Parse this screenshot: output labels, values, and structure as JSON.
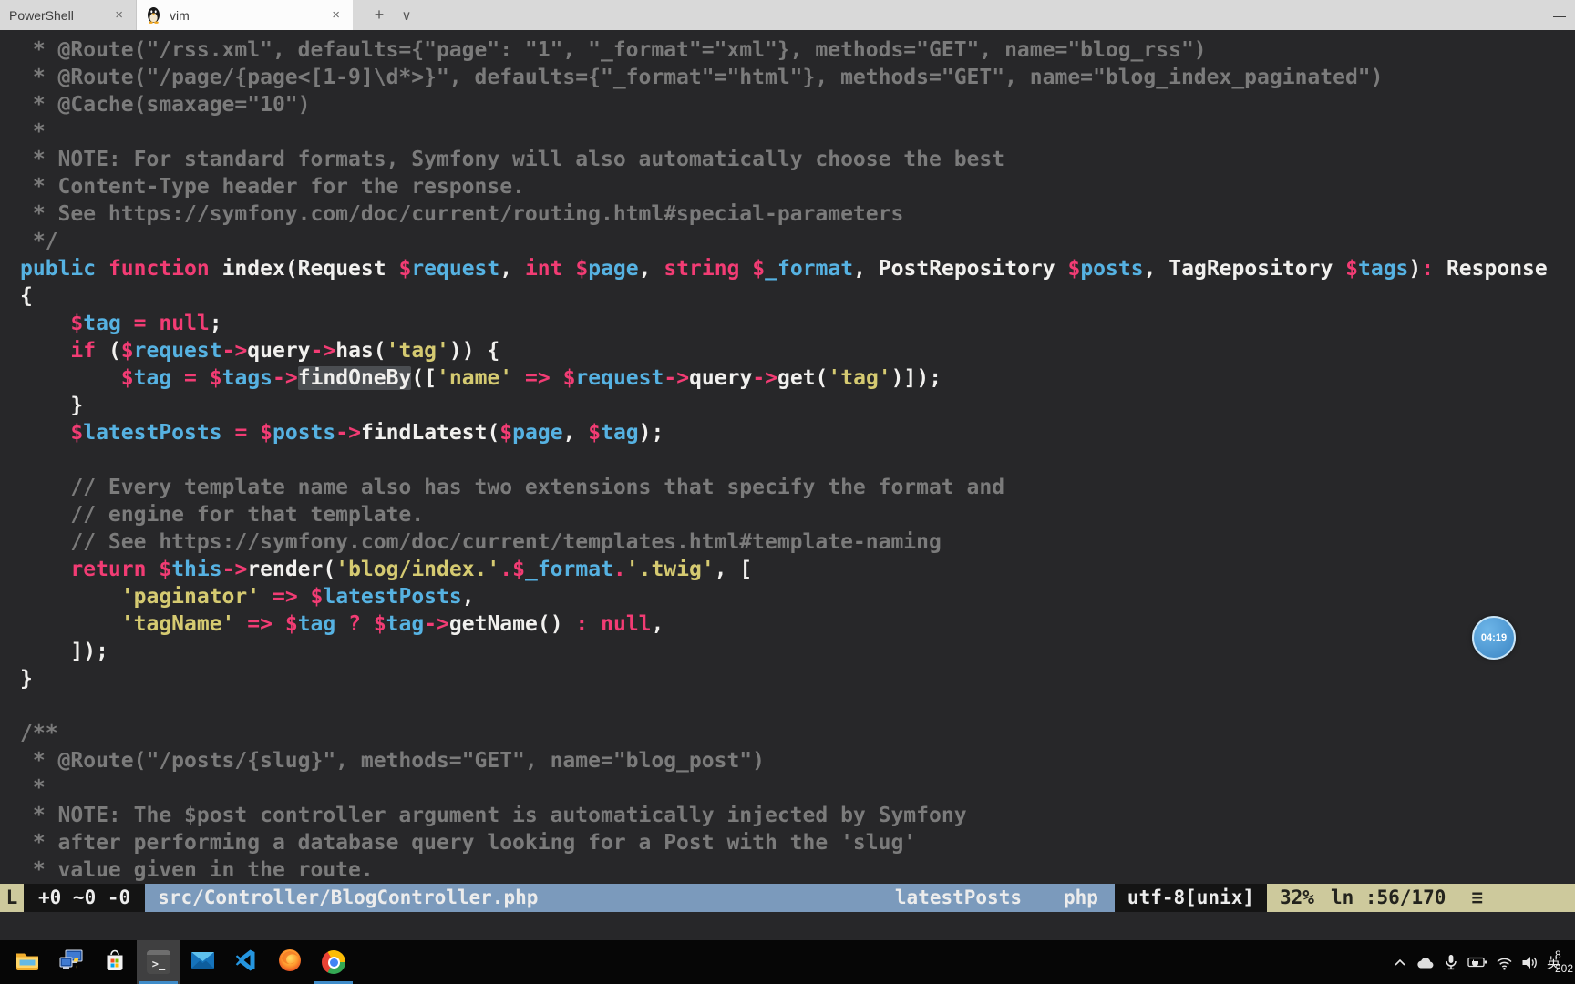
{
  "window": {
    "tabs": [
      {
        "label": "PowerShell"
      },
      {
        "label": "vim",
        "icon": "tux-linux"
      }
    ],
    "close_glyph": "×",
    "new_tab_glyph": "+",
    "dropdown_glyph": "∨",
    "minimize_glyph": "—"
  },
  "editor": {
    "lines": [
      {
        "segs": [
          [
            "g",
            " * @Route(\"/rss.xml\", defaults={\"page\": \"1\", \"_format\"=\"xml\"}, methods=\"GET\", name=\"blog_rss\")"
          ]
        ]
      },
      {
        "segs": [
          [
            "g",
            " * @Route(\"/page/{page<[1-9]\\d*>}\", defaults={\"_format\"=\"html\"}, methods=\"GET\", name=\"blog_index_paginated\")"
          ]
        ]
      },
      {
        "segs": [
          [
            "g",
            " * @Cache(smaxage=\"10\")"
          ]
        ]
      },
      {
        "segs": [
          [
            "g",
            " *"
          ]
        ]
      },
      {
        "segs": [
          [
            "g",
            " * NOTE: For standard formats, Symfony will also automatically choose the best"
          ]
        ]
      },
      {
        "segs": [
          [
            "g",
            " * Content-Type header for the response."
          ]
        ]
      },
      {
        "segs": [
          [
            "g",
            " * See https://symfony.com/doc/current/routing.html#special-parameters"
          ]
        ]
      },
      {
        "segs": [
          [
            "g",
            " */"
          ]
        ]
      },
      {
        "segs": [
          [
            "b",
            "public"
          ],
          [
            "w",
            " "
          ],
          [
            "p",
            "function"
          ],
          [
            "w",
            " index(Request "
          ],
          [
            "p",
            "$"
          ],
          [
            "b",
            "request"
          ],
          [
            "w",
            ", "
          ],
          [
            "p",
            "int"
          ],
          [
            "w",
            " "
          ],
          [
            "p",
            "$"
          ],
          [
            "b",
            "page"
          ],
          [
            "w",
            ", "
          ],
          [
            "p",
            "string"
          ],
          [
            "w",
            " "
          ],
          [
            "p",
            "$"
          ],
          [
            "b",
            "_format"
          ],
          [
            "w",
            ", PostRepository "
          ],
          [
            "p",
            "$"
          ],
          [
            "b",
            "posts"
          ],
          [
            "w",
            ", TagRepository "
          ],
          [
            "p",
            "$"
          ],
          [
            "b",
            "tags"
          ],
          [
            "w",
            ")"
          ],
          [
            "p",
            ":"
          ],
          [
            "w",
            " Response"
          ]
        ]
      },
      {
        "segs": [
          [
            "w",
            "{"
          ]
        ]
      },
      {
        "segs": [
          [
            "w",
            "    "
          ],
          [
            "p",
            "$"
          ],
          [
            "b",
            "tag"
          ],
          [
            "w",
            " "
          ],
          [
            "p",
            "="
          ],
          [
            "w",
            " "
          ],
          [
            "p",
            "null"
          ],
          [
            "w",
            ";"
          ]
        ]
      },
      {
        "segs": [
          [
            "w",
            "    "
          ],
          [
            "p",
            "if"
          ],
          [
            "w",
            " ("
          ],
          [
            "p",
            "$"
          ],
          [
            "b",
            "request"
          ],
          [
            "p",
            "->"
          ],
          [
            "w",
            "query"
          ],
          [
            "p",
            "->"
          ],
          [
            "w",
            "has("
          ],
          [
            "y",
            "'tag'"
          ],
          [
            "w",
            ")) {"
          ]
        ]
      },
      {
        "segs": [
          [
            "w",
            "        "
          ],
          [
            "p",
            "$"
          ],
          [
            "b",
            "tag"
          ],
          [
            "w",
            " "
          ],
          [
            "p",
            "="
          ],
          [
            "w",
            " "
          ],
          [
            "p",
            "$"
          ],
          [
            "b",
            "tags"
          ],
          [
            "p",
            "->"
          ],
          [
            "w",
            "findOneBy",
            "hl"
          ],
          [
            "w",
            "(["
          ],
          [
            "y",
            "'name'"
          ],
          [
            "w",
            " "
          ],
          [
            "p",
            "=>"
          ],
          [
            "w",
            " "
          ],
          [
            "p",
            "$"
          ],
          [
            "b",
            "request"
          ],
          [
            "p",
            "->"
          ],
          [
            "w",
            "query"
          ],
          [
            "p",
            "->"
          ],
          [
            "w",
            "get("
          ],
          [
            "y",
            "'tag'"
          ],
          [
            "w",
            ")]);"
          ]
        ]
      },
      {
        "segs": [
          [
            "w",
            "    }"
          ]
        ]
      },
      {
        "segs": [
          [
            "w",
            "    "
          ],
          [
            "p",
            "$"
          ],
          [
            "b",
            "latestPosts"
          ],
          [
            "w",
            " "
          ],
          [
            "p",
            "="
          ],
          [
            "w",
            " "
          ],
          [
            "p",
            "$"
          ],
          [
            "b",
            "posts"
          ],
          [
            "p",
            "->"
          ],
          [
            "w",
            "findLatest("
          ],
          [
            "p",
            "$"
          ],
          [
            "b",
            "page"
          ],
          [
            "w",
            ", "
          ],
          [
            "p",
            "$"
          ],
          [
            "b",
            "tag"
          ],
          [
            "w",
            ");"
          ]
        ]
      },
      {
        "segs": []
      },
      {
        "segs": [
          [
            "g",
            "    // Every template name also has two extensions that specify the format and"
          ]
        ]
      },
      {
        "segs": [
          [
            "g",
            "    // engine for that template."
          ]
        ]
      },
      {
        "segs": [
          [
            "g",
            "    // See https://symfony.com/doc/current/templates.html#template-naming"
          ]
        ]
      },
      {
        "segs": [
          [
            "w",
            "    "
          ],
          [
            "p",
            "return"
          ],
          [
            "w",
            " "
          ],
          [
            "p",
            "$"
          ],
          [
            "b",
            "this"
          ],
          [
            "p",
            "->"
          ],
          [
            "w",
            "render("
          ],
          [
            "y",
            "'blog/index.'"
          ],
          [
            "p",
            "."
          ],
          [
            "p",
            "$"
          ],
          [
            "b",
            "_format"
          ],
          [
            "p",
            "."
          ],
          [
            "y",
            "'.twig'"
          ],
          [
            "w",
            ", ["
          ]
        ]
      },
      {
        "segs": [
          [
            "w",
            "        "
          ],
          [
            "y",
            "'paginator'"
          ],
          [
            "w",
            " "
          ],
          [
            "p",
            "=>"
          ],
          [
            "w",
            " "
          ],
          [
            "p",
            "$"
          ],
          [
            "b",
            "latestPosts"
          ],
          [
            "w",
            ","
          ]
        ]
      },
      {
        "segs": [
          [
            "w",
            "        "
          ],
          [
            "y",
            "'tagName'"
          ],
          [
            "w",
            " "
          ],
          [
            "p",
            "=>"
          ],
          [
            "w",
            " "
          ],
          [
            "p",
            "$"
          ],
          [
            "b",
            "tag"
          ],
          [
            "w",
            " "
          ],
          [
            "p",
            "?"
          ],
          [
            "w",
            " "
          ],
          [
            "p",
            "$"
          ],
          [
            "b",
            "tag"
          ],
          [
            "p",
            "->"
          ],
          [
            "w",
            "getName() "
          ],
          [
            "p",
            ":"
          ],
          [
            "w",
            " "
          ],
          [
            "p",
            "null"
          ],
          [
            "w",
            ","
          ]
        ]
      },
      {
        "segs": [
          [
            "w",
            "    ]);"
          ]
        ]
      },
      {
        "segs": [
          [
            "w",
            "}"
          ]
        ]
      },
      {
        "segs": []
      },
      {
        "segs": [
          [
            "g",
            "/**"
          ]
        ]
      },
      {
        "segs": [
          [
            "g",
            " * @Route(\"/posts/{slug}\", methods=\"GET\", name=\"blog_post\")"
          ]
        ]
      },
      {
        "segs": [
          [
            "g",
            " *"
          ]
        ]
      },
      {
        "segs": [
          [
            "g",
            " * NOTE: The $post controller argument is automatically injected by Symfony"
          ]
        ]
      },
      {
        "segs": [
          [
            "g",
            " * after performing a database query looking for a Post with the 'slug'"
          ]
        ]
      },
      {
        "segs": [
          [
            "g",
            " * value given in the route."
          ]
        ]
      }
    ]
  },
  "statusline": {
    "mode_truncated": "L",
    "git_hunks": "+0 ~0 -0",
    "file_path": "src/Controller/BlogController.php",
    "current_word": "latestPosts",
    "filetype": "php",
    "encoding": "utf-8[unix]",
    "scroll_percent": "32%",
    "line_info": "ln :56/170",
    "menu_glyph": "≡"
  },
  "badge": {
    "timer": "04:19"
  },
  "taskbar": {
    "apps": [
      "file-explorer",
      "remote-desktop",
      "microsoft-store",
      "windows-terminal",
      "mail",
      "vscode",
      "firefox",
      "chrome"
    ],
    "active_app": "windows-terminal",
    "running_apps": [
      "windows-terminal",
      "chrome"
    ],
    "terminal_prompt_glyph": ">_",
    "tray": {
      "chevron_glyph": "∧",
      "icons": [
        "hidden-icons-chevron",
        "onedrive-cloud",
        "microphone",
        "battery",
        "wifi",
        "volume",
        "ime-language",
        "clock"
      ],
      "lang": "英",
      "clock_top": "8",
      "clock_bottom": "202"
    }
  },
  "colors": {
    "terminal_bg": "#272729",
    "keyword_pink": "#f23c74",
    "identifier_blue": "#56b2e2",
    "string_yellow": "#d5ca71",
    "comment_gray": "#7b7b7b",
    "plain_white": "#f1f0ee",
    "statusline_blue": "#7b9abc",
    "statusline_khaki": "#cdc99c",
    "statusline_black": "#141414",
    "taskbar_accent": "#3f8cc9",
    "badge_blue": "#3c86c4"
  }
}
